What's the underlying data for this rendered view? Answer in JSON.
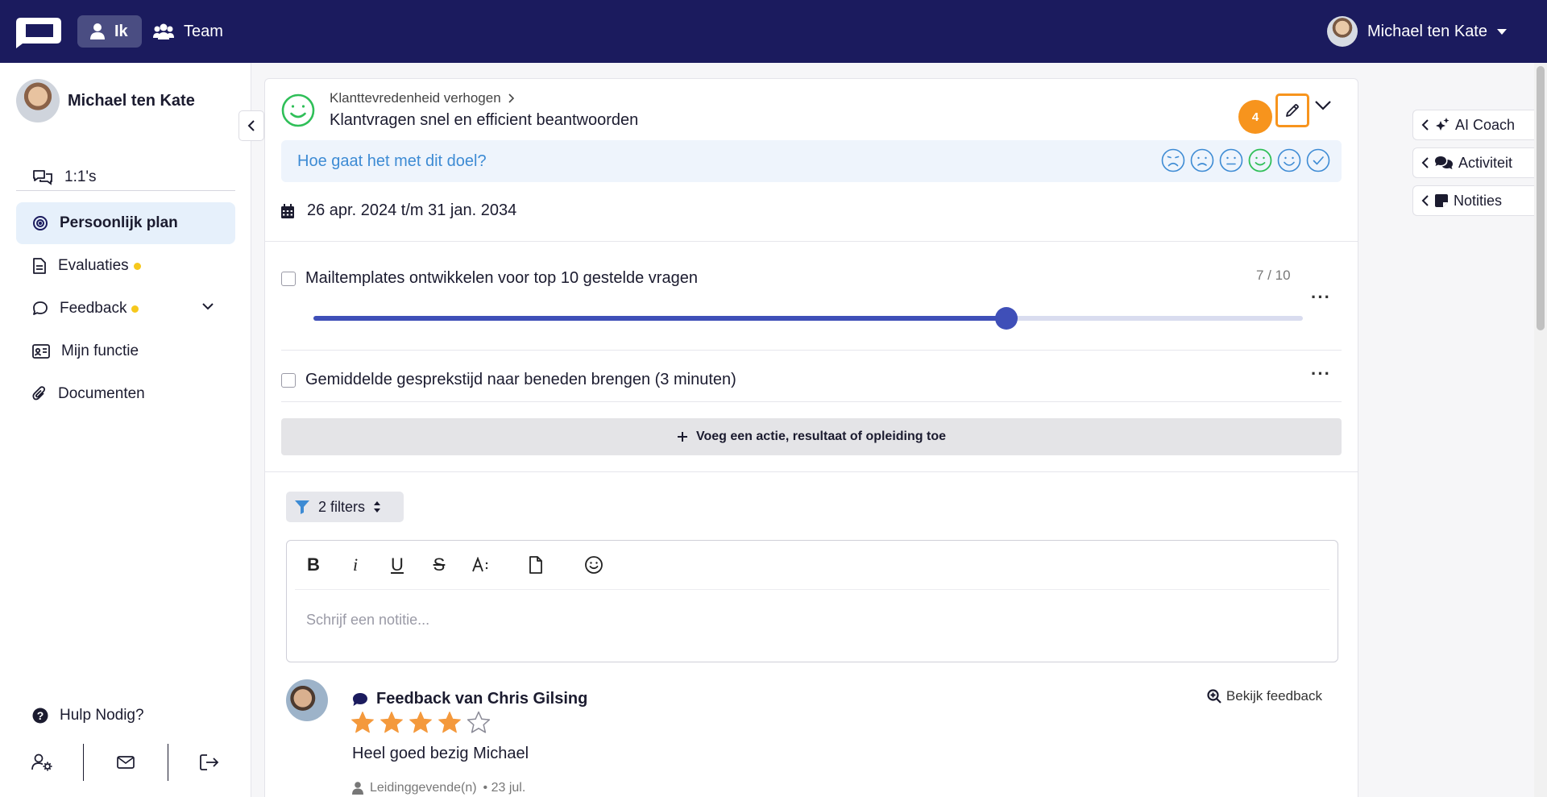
{
  "topbar": {
    "nav_me": "Ik",
    "nav_team": "Team",
    "user_name": "Michael ten Kate"
  },
  "sidebar": {
    "profile_name": "Michael ten Kate",
    "one_on_ones": "1:1's",
    "items": [
      {
        "label": "Persoonlijk plan",
        "active": true
      },
      {
        "label": "Evaluaties",
        "notification_dot": true
      },
      {
        "label": "Feedback",
        "notification_dot": true,
        "expandable": true
      },
      {
        "label": "Mijn functie"
      },
      {
        "label": "Documenten"
      }
    ],
    "help": "Hulp Nodig?"
  },
  "goal": {
    "breadcrumb": "Klanttevredenheid verhogen",
    "title": "Klantvragen snel en efficient beantwoorden",
    "step_badge": "4",
    "status_question": "Hoe gaat het met dit doel?",
    "date_range": "26 apr. 2024 t/m 31 jan. 2034",
    "moods": [
      "very-sad",
      "sad",
      "neutral",
      "happy",
      "very-happy",
      "done"
    ],
    "selected_mood": "happy"
  },
  "tasks": [
    {
      "label": "Mailtemplates ontwikkelen voor top 10 gestelde vragen",
      "progress_text": "7 / 10",
      "progress": 0.7
    },
    {
      "label": "Gemiddelde gesprekstijd naar beneden brengen (3 minuten)"
    }
  ],
  "add_action_label": "Voeg een actie, resultaat of opleiding toe",
  "filters_label": "2 filters",
  "editor": {
    "placeholder": "Schrijf een notitie..."
  },
  "feedback": {
    "title": "Feedback van Chris Gilsing",
    "view_link": "Bekijk feedback",
    "rating": 4,
    "max_rating": 5,
    "text": "Heel goed bezig Michael",
    "meta_role": "Leidinggevende(n)",
    "meta_date": "• 23 jul."
  },
  "right_tabs": [
    "AI Coach",
    "Activiteit",
    "Notities"
  ],
  "colors": {
    "topbar": "#1b1b5e",
    "accent_orange": "#f7941d",
    "progress_blue": "#3f4fb8",
    "link_blue": "#3d8bd4",
    "mood_green": "#2fbf58",
    "star_orange": "#f4993c"
  }
}
